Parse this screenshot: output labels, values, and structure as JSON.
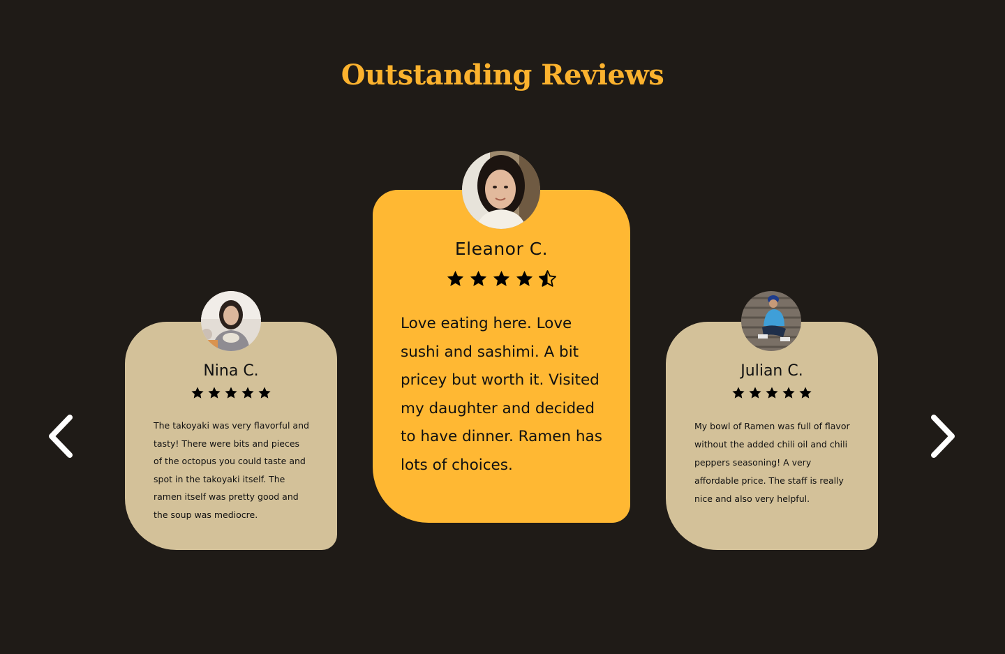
{
  "section": {
    "title": "Outstanding Reviews"
  },
  "colors": {
    "background": "#1f1b17",
    "accent": "#fbb22e",
    "featured_card": "#ffb833",
    "side_card": "#d3c199",
    "star": "#000000"
  },
  "carousel": {
    "prev_icon": "chevron-left-icon",
    "next_icon": "chevron-right-icon",
    "reviews": [
      {
        "name": "Nina C.",
        "rating": 5,
        "text": "The takoyaki was very flavorful and tasty! There were bits and pieces of the octopus you could taste and spot in the takoyaki itself. The ramen itself was pretty good and the soup was mediocre."
      },
      {
        "name": "Eleanor C.",
        "rating": 4.5,
        "text": "Love eating here. Love sushi and sashimi. A bit pricey but worth it. Visited my daughter and decided to have dinner. Ramen has lots of choices."
      },
      {
        "name": "Julian C.",
        "rating": 5,
        "text": "My bowl of Ramen was full of flavor without the added chili oil and chili peppers seasoning! A very affordable price. The staff is really nice and also very helpful."
      }
    ]
  }
}
